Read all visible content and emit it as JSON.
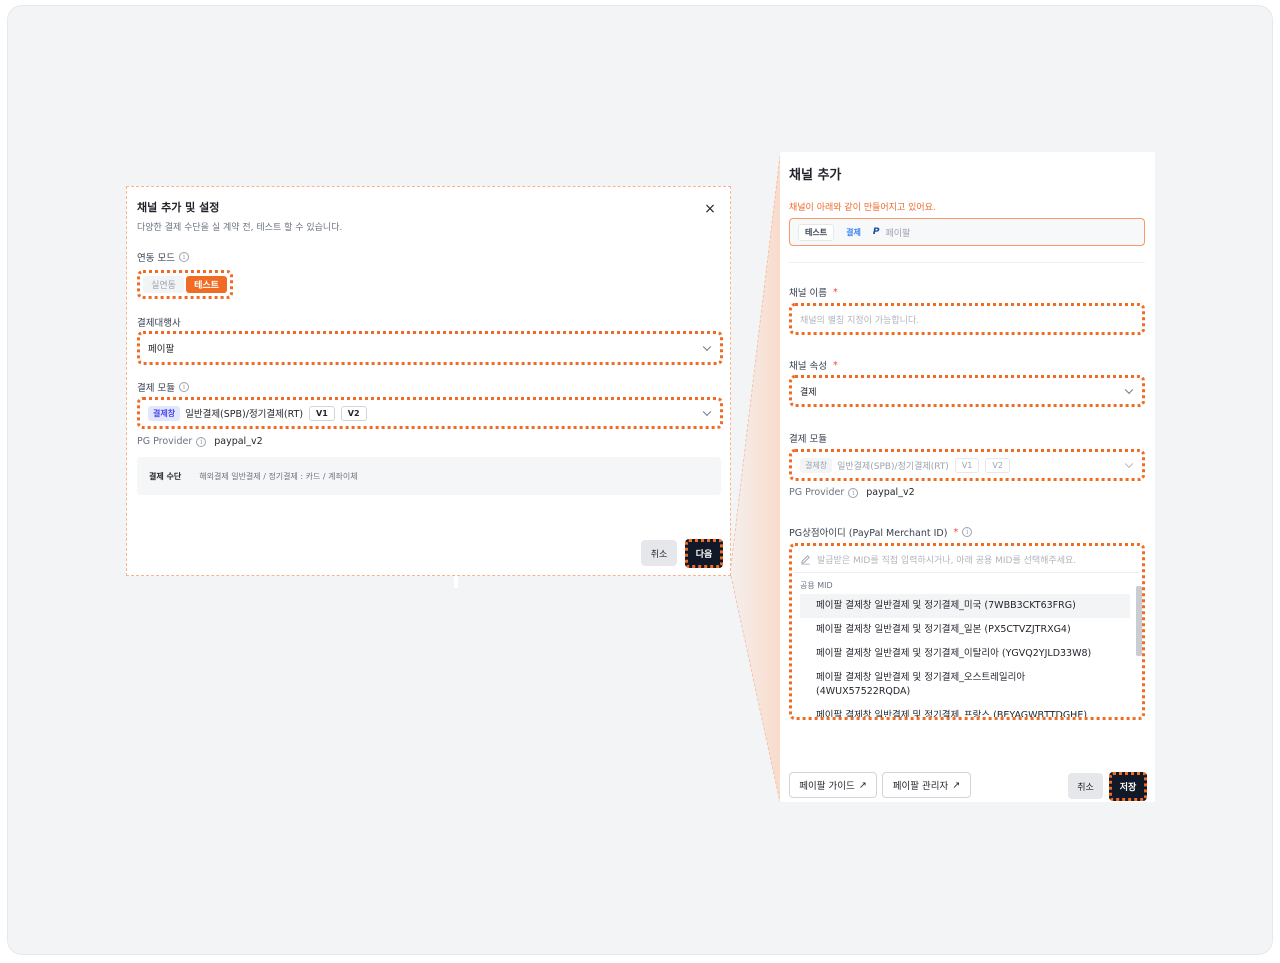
{
  "left_modal": {
    "title": "채널 추가 및 설정",
    "subtitle": "다양한 결제 수단을 실 계약 전, 테스트 할 수 있습니다.",
    "close_icon": "×",
    "mode_label": "연동 모드",
    "mode_options": [
      "실연동",
      "테스트"
    ],
    "mode_selected": "테스트",
    "pg_label": "결제대행사",
    "pg_value": "페이팔",
    "module_label": "결제 모듈",
    "module_tag": "결제창",
    "module_value": "일반결제(SPB)/정기결제(RT)",
    "module_versions": [
      "V1",
      "V2"
    ],
    "pg_provider_label": "PG Provider",
    "pg_provider_value": "paypal_v2",
    "method_key": "결제 수단",
    "method_value": "해외결제 일반결제 / 정기결제 : 카드 / 계좌이체",
    "cancel_label": "취소",
    "next_label": "다음"
  },
  "right_panel": {
    "title": "채널 추가",
    "notice": "채널이 아래와 같이 만들어지고 있어요.",
    "preview": {
      "chip_test": "테스트",
      "chip_payment": "결제",
      "paypal_logo": "P",
      "paypal_name": "페이팔"
    },
    "channel_name_label": "채널 이름",
    "channel_name_placeholder": "채널의 별칭 지정이 가능합니다.",
    "channel_attr_label": "채널 속성",
    "channel_attr_value": "결제",
    "module_label": "결제 모듈",
    "module_tag": "결제창",
    "module_value": "일반결제(SPB)/정기결제(RT)",
    "module_versions": [
      "V1",
      "V2"
    ],
    "pg_provider_label": "PG Provider",
    "pg_provider_value": "paypal_v2",
    "mid_label": "PG상점아이디 (PayPal Merchant ID)",
    "required_mark": "*",
    "mid_placeholder": "발급받은 MID를 직접 입력하시거나, 아래 공용 MID를 선택해주세요.",
    "mid_group": "공용 MID",
    "mid_options": [
      "페이팔 결제창 일반결제 및 정기결제_미국 (7WBB3CKT63FRG)",
      "페이팔 결제창 일반결제 및 정기결제_일본 (PX5CTVZJTRXG4)",
      "페이팔 결제창 일반결제 및 정기결제_이탈리아 (YGVQ2YJLD33W8)",
      "페이팔 결제창 일반결제 및 정기결제_오스트레일리아 (4WUX57522RQDA)",
      "페이팔 결제창 일반결제 및 정기결제_프랑스 (BEYAGWBTTDGHE)"
    ],
    "guide_button": "페이팔 가이드",
    "admin_button": "페이팔 관리자",
    "external_arrow": "↗",
    "cancel_label": "취소",
    "save_label": "저장"
  },
  "colors": {
    "accent": "#f06b24",
    "dark_button": "#111827",
    "notice": "#ef6a2c"
  }
}
